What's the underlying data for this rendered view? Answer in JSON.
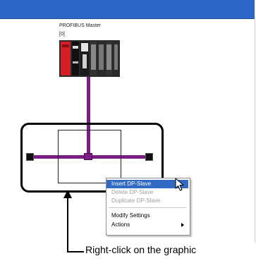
{
  "diagram": {
    "master_title": "PROFIBUS Master",
    "master_index": "[0]"
  },
  "context_menu": {
    "items": [
      {
        "label": "Insert DP-Slave",
        "state": "selected"
      },
      {
        "label": "Delete DP-Slave",
        "state": "disabled"
      },
      {
        "label": "Duplicate DP-Slave",
        "state": "disabled"
      },
      {
        "label": "Modify Settings",
        "state": "enabled"
      },
      {
        "label": "Actions",
        "state": "enabled",
        "has_submenu": true
      }
    ]
  },
  "caption": "Right-click on the graphic",
  "colors": {
    "titlebar": "#2d68c8",
    "bus": "#7a1e86",
    "menu_highlight": "#316ac5",
    "device_red": "#d41f26"
  }
}
